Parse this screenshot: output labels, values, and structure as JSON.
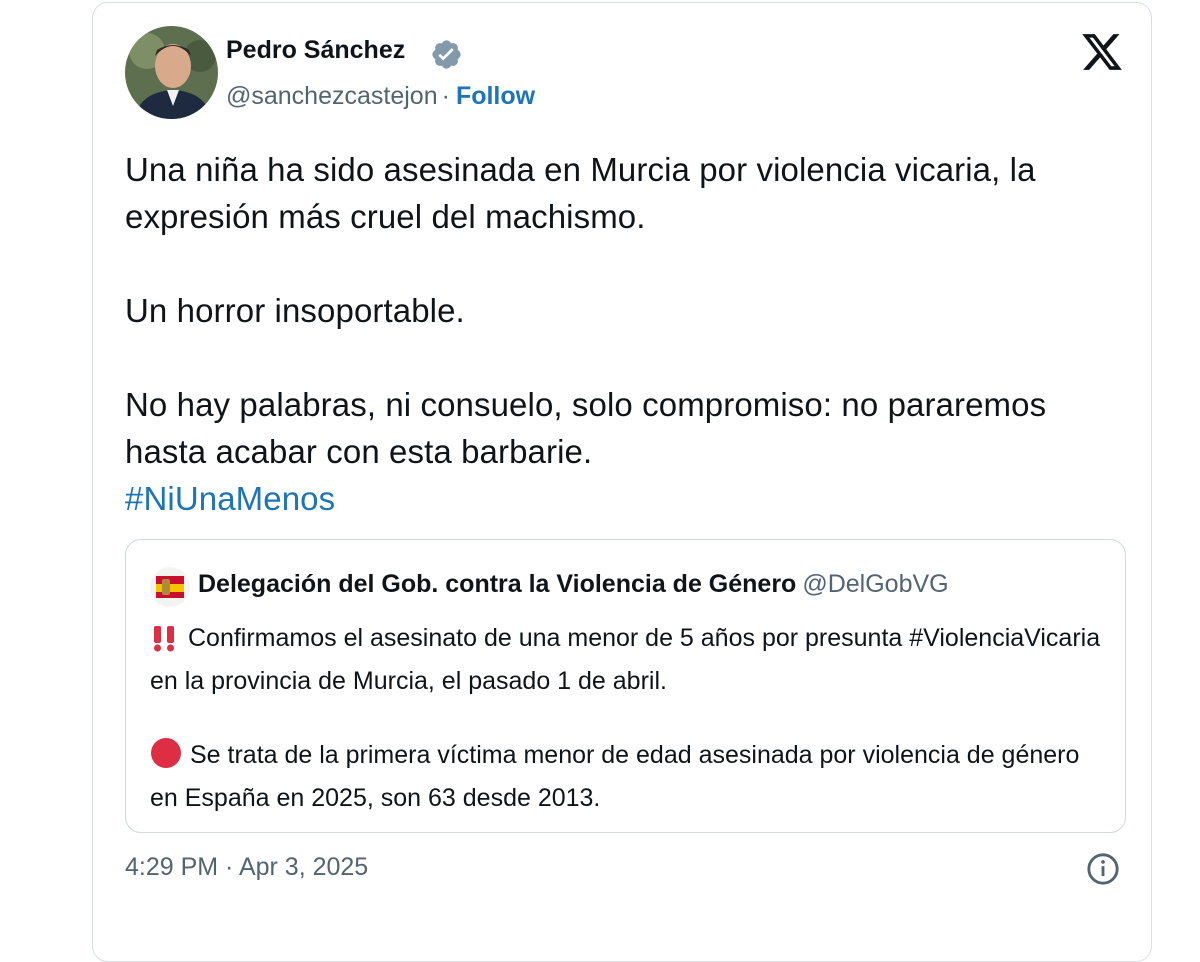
{
  "tweet": {
    "author": {
      "name": "Pedro Sánchez",
      "handle": "@sanchezcastejon",
      "separator": "·",
      "follow_label": "Follow",
      "verified_icon": "verified-badge-icon",
      "verified_color": "#829aab"
    },
    "platform_icon": "x-logo-icon",
    "text": {
      "line1": "Una niña ha sido asesinada en Murcia por violencia vicaria, la expresión más cruel del machismo.",
      "line2": "Un horror insoportable.",
      "line3": "No hay palabras, ni consuelo, solo compromiso: no pararemos hasta acabar con esta barbarie.",
      "hashtag": "#NiUnaMenos"
    },
    "quote": {
      "author_name": "Delegación del Gob. contra la Violencia de Género",
      "author_handle": "@DelGobVG",
      "paragraph1_icon": "double-exclamation-icon",
      "paragraph1": "Confirmamos el asesinato de una menor de 5 años por presunta #ViolenciaVicaria en la provincia de Murcia, el pasado 1 de abril.",
      "paragraph2_icon": "red-circle-icon",
      "paragraph2": "Se trata de la primera víctima menor de edad asesinada por violencia de género en España en 2025, son 63 desde 2013."
    },
    "timestamp": "4:29 PM · Apr 3, 2025",
    "info_icon": "info-icon",
    "colors": {
      "text": "#0f1419",
      "secondary": "#536471",
      "link": "#1d74b8",
      "emoji_red": "#dd2e44",
      "border": "#cfd9de"
    }
  }
}
